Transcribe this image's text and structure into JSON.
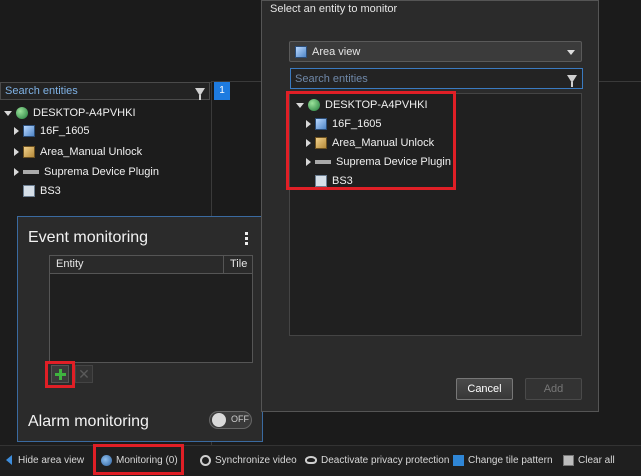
{
  "left_panel": {
    "search_placeholder": "Search entities",
    "tab_badge": "1",
    "tree": [
      {
        "label": "DESKTOP-A4PVHKI",
        "icon": "server-globe-icon",
        "expanded": true
      },
      {
        "label": "16F_1605",
        "icon": "area-icon"
      },
      {
        "label": "Area_Manual Unlock",
        "icon": "area-lock-icon"
      },
      {
        "label": "Suprema Device Plugin",
        "icon": "plugin-icon"
      },
      {
        "label": "BS3",
        "icon": "device-icon"
      }
    ]
  },
  "event_monitoring": {
    "title": "Event monitoring",
    "columns": [
      "Entity",
      "Tile"
    ],
    "add_button": "add-icon",
    "remove_button": "remove-icon",
    "remove_glyph": "✕"
  },
  "alarm_monitoring": {
    "title": "Alarm monitoring",
    "toggle_label": "OFF"
  },
  "dialog": {
    "title": "Select an entity to monitor",
    "view_select": "Area view",
    "search_placeholder": "Search entities",
    "tree": [
      {
        "label": "DESKTOP-A4PVHKI",
        "icon": "server-globe-icon",
        "expanded": true
      },
      {
        "label": "16F_1605",
        "icon": "area-icon"
      },
      {
        "label": "Area_Manual Unlock",
        "icon": "area-lock-icon"
      },
      {
        "label": "Suprema Device Plugin",
        "icon": "plugin-icon"
      },
      {
        "label": "BS3",
        "icon": "device-icon"
      }
    ],
    "cancel_label": "Cancel",
    "add_label": "Add"
  },
  "bottom_bar": {
    "hide_area_view": "Hide area view",
    "monitoring": "Monitoring (0)",
    "synchronize_video": "Synchronize video",
    "deactivate_privacy": "Deactivate privacy protection",
    "change_tile_pattern": "Change tile pattern",
    "clear_all": "Clear all"
  },
  "colors": {
    "highlight": "#e01f26",
    "accent": "#1e7be0",
    "add_green": "#3fb33f"
  }
}
